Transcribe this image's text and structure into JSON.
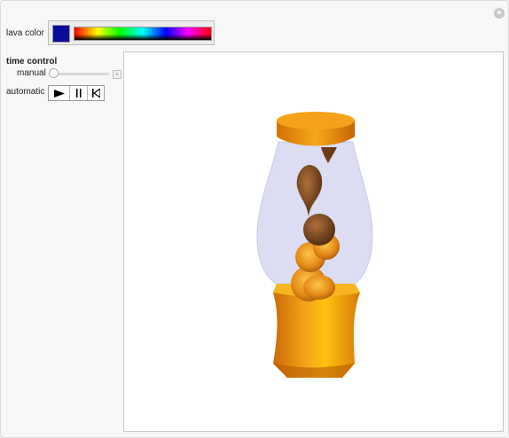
{
  "controls": {
    "lava_color_label": "lava color",
    "lava_color": "#0b0b9a",
    "time_control_label": "time control",
    "manual_label": "manual",
    "manual_value": 0,
    "automatic_label": "automatic",
    "buttons": [
      "play-icon",
      "pause-icon",
      "reset-icon"
    ]
  },
  "colors": {
    "lamp_body": "#f09a14",
    "glass": "#dcdcf2",
    "lava": "#8a4a1f"
  },
  "icons": {
    "corner": "plus-circle-icon"
  }
}
